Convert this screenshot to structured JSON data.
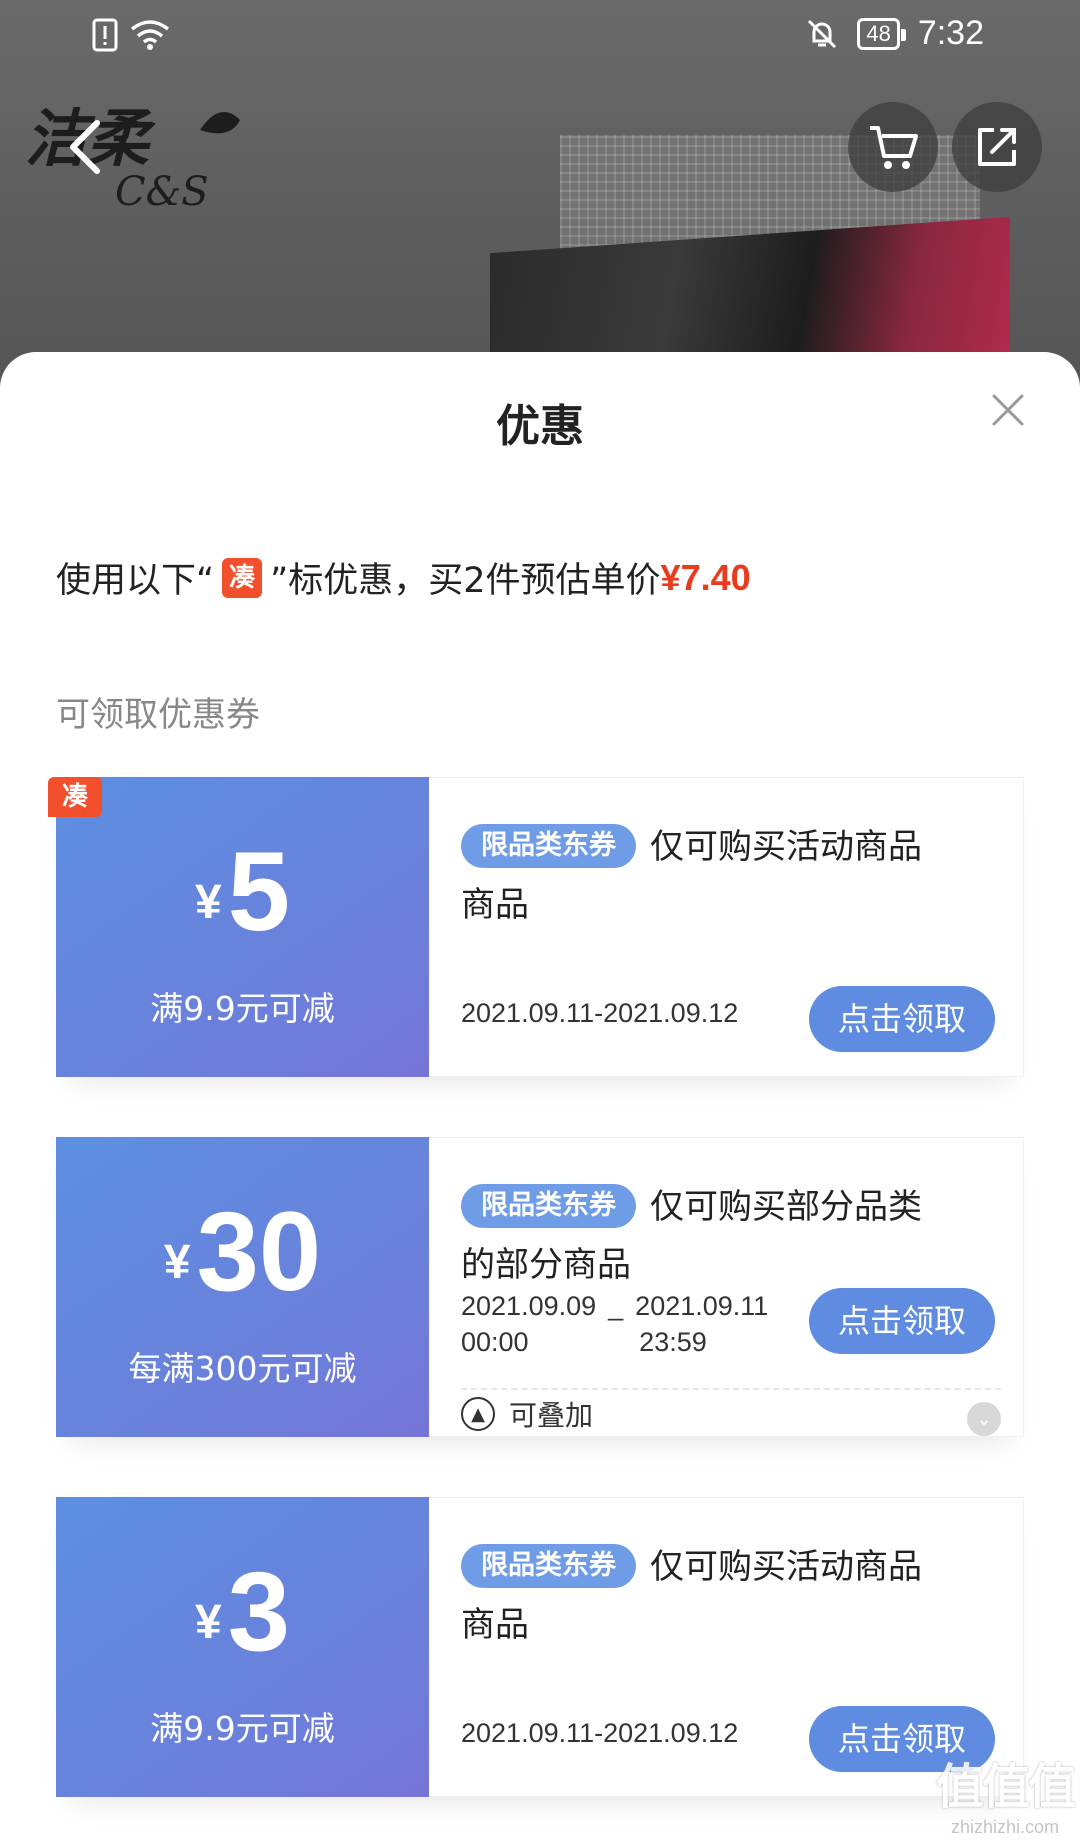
{
  "status_bar": {
    "time": "7:32",
    "battery": "48",
    "icons": [
      "alert-icon",
      "wifi-icon",
      "mute-icon",
      "battery-icon"
    ]
  },
  "header": {
    "brand_logo_text": "洁柔 C&S",
    "buttons": [
      "back-icon",
      "cart-icon",
      "share-icon"
    ]
  },
  "sheet": {
    "title": "优惠",
    "summary_prefix": "使用以下“",
    "summary_tag": "凑",
    "summary_middle": "”标优惠，买2件预估单价",
    "summary_price": "¥7.40",
    "section_label": "可领取优惠券"
  },
  "coupons": [
    {
      "corner_tag": "凑",
      "yen": "¥",
      "amount": "5",
      "condition": "满9.9元可减",
      "pill": "限品类东券",
      "desc": "仅可购买活动商品商品",
      "date": "2021.09.11-2021.09.12",
      "button": "点击领取"
    },
    {
      "yen": "¥",
      "amount": "30",
      "condition": "每满300元可减",
      "pill": "限品类东券",
      "desc": "仅可购买部分品类的部分商品",
      "date_start": "2021.09.09\n00:00",
      "date_sep": "_",
      "date_end": "2021.09.11\n23:59",
      "date_start_day": "2021.09.09",
      "date_start_time": "00:00",
      "date_end_day": "2021.09.11",
      "date_end_time": "23:59",
      "button": "点击领取",
      "stack_label": "可叠加"
    },
    {
      "yen": "¥",
      "amount": "3",
      "condition": "满9.9元可减",
      "pill": "限品类东券",
      "desc": "仅可购买活动商品商品",
      "date": "2021.09.11-2021.09.12",
      "button": "点击领取"
    }
  ],
  "colors": {
    "accent_blue": "#5f8ce0",
    "price_red": "#e93b1d",
    "tag_orange": "#f2502c"
  },
  "watermark": {
    "big": "值值值",
    "small": "zhizhizhi.com"
  }
}
